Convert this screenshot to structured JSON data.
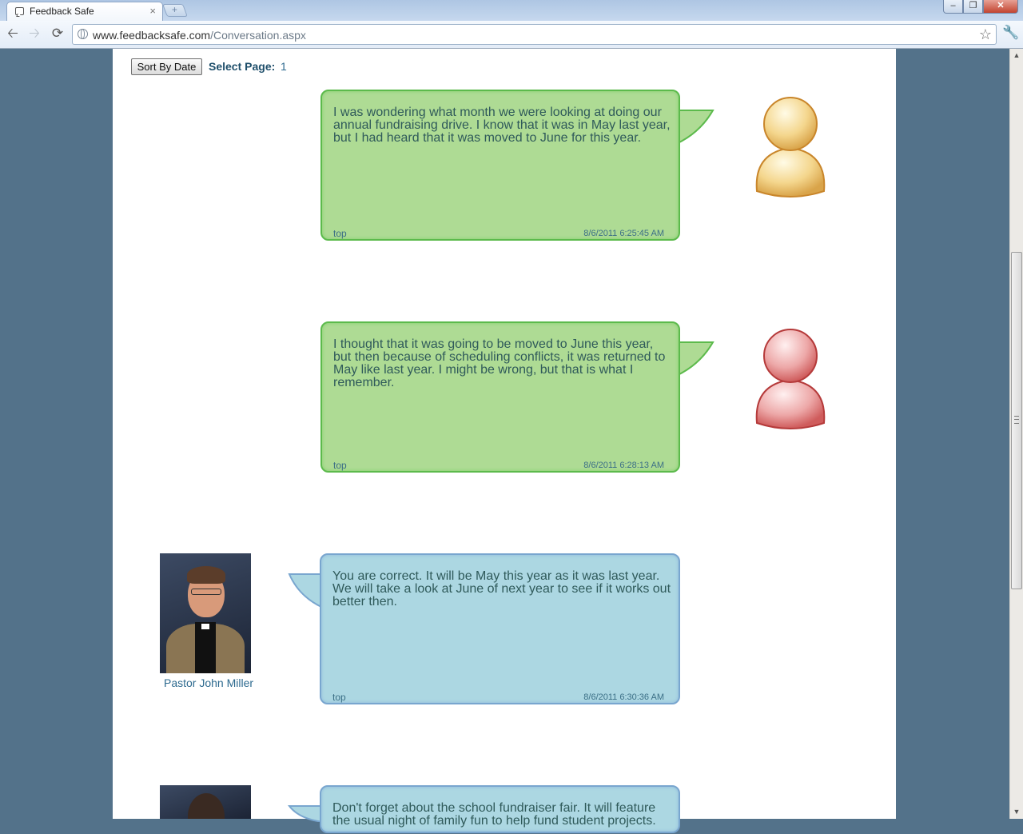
{
  "browser": {
    "tab_title": "Feedback Safe",
    "tab_close": "×",
    "new_tab": "+",
    "url_host": "www.feedbacksafe.com",
    "url_path": "/Conversation.aspx",
    "window_controls": {
      "minimize": "–",
      "restore": "❐",
      "close": "✕"
    }
  },
  "toolbar": {
    "sort_label": "Sort By Date",
    "page_label": "Select Page:",
    "page_number": "1"
  },
  "messages": [
    {
      "text": "I was wondering what month we were looking at doing our annual fundraising drive. I know that it was in May last year, but I had heard that it was moved to June for this year.",
      "top": "top",
      "timestamp": "8/6/2011 6:25:45 AM",
      "avatar": "user-icon-yellow"
    },
    {
      "text": "I thought that it was going to be moved to June this year, but then because of scheduling conflicts, it was returned to May like last year. I might be wrong, but that is what I remember.",
      "top": "top",
      "timestamp": "8/6/2011 6:28:13 AM",
      "avatar": "user-icon-red"
    },
    {
      "text": "You are correct. It will be May this year as it was last year. We will take a look at June of next year to see if it works out better then.",
      "top": "top",
      "timestamp": "8/6/2011 6:30:36 AM",
      "author": "Pastor John Miller"
    },
    {
      "text": "Don't forget about the school fundraiser fair. It will feature the usual night of family fun to help fund student projects."
    }
  ],
  "colors": {
    "page_bg": "#53728a",
    "green_bubble": "#aedb94",
    "blue_bubble": "#acd7e2",
    "link": "#2d6a8f"
  }
}
